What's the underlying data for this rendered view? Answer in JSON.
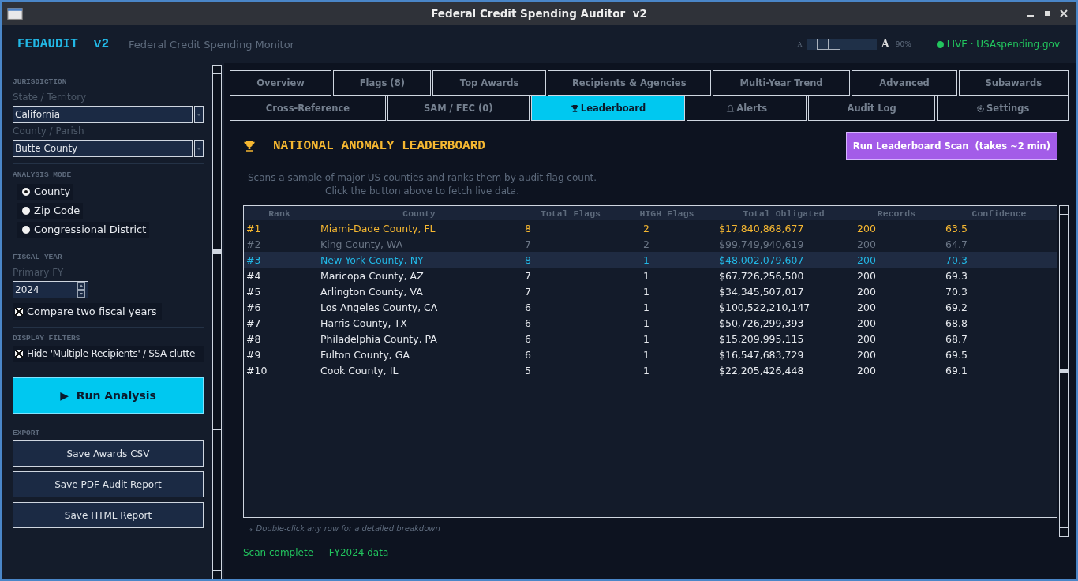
{
  "window": {
    "title": "Federal Credit Spending Auditor  v2"
  },
  "header": {
    "brand": "FEDAUDIT",
    "version": "v2",
    "subtitle": "Federal Credit Spending Monitor",
    "zoom": {
      "small_label": "A",
      "large_label": "A",
      "level": 0.2,
      "reading": "90%"
    },
    "status": {
      "text": "LIVE · USAspending.gov",
      "color": "#22c55e"
    }
  },
  "sidebar": {
    "jurisdiction": {
      "heading": "JURISDICTION",
      "fields": [
        {
          "label": "State / Territory",
          "value": "California"
        },
        {
          "label": "County / Parish",
          "value": "Butte County"
        }
      ]
    },
    "analysis_mode": {
      "heading": "ANALYSIS MODE",
      "options": [
        {
          "label": "County",
          "selected": true
        },
        {
          "label": "Zip Code",
          "selected": false
        },
        {
          "label": "Congressional District",
          "selected": false
        }
      ]
    },
    "fiscal_year": {
      "heading": "FISCAL YEAR",
      "label": "Primary FY",
      "value": "2024",
      "compare": {
        "label": "Compare two fiscal years",
        "checked": true
      }
    },
    "display_filters": {
      "heading": "DISPLAY FILTERS",
      "hide": {
        "label": "Hide 'Multiple Recipients' / SSA clutte",
        "checked": true
      }
    },
    "run_button": "▶  Run Analysis",
    "export": {
      "heading": "EXPORT",
      "buttons": [
        "Save Awards CSV",
        "Save PDF Audit Report",
        "Save HTML Report"
      ]
    }
  },
  "tabs": [
    [
      {
        "label": "Overview",
        "selected": false
      },
      {
        "label": "Flags (8)",
        "selected": false
      },
      {
        "label": "Top Awards",
        "selected": false
      },
      {
        "label": "Recipients & Agencies",
        "selected": false
      },
      {
        "label": "Multi-Year Trend",
        "selected": false
      },
      {
        "label": "Advanced",
        "selected": false
      },
      {
        "label": "Subawards",
        "selected": false
      }
    ],
    [
      {
        "label": "Cross-Reference",
        "selected": false
      },
      {
        "label": "SAM / FEC (0)",
        "selected": false
      },
      {
        "label": "Leaderboard",
        "selected": true
      },
      {
        "label": "Alerts",
        "selected": false
      },
      {
        "label": "Audit Log",
        "selected": false
      },
      {
        "label": "Settings",
        "selected": false
      }
    ]
  ],
  "leaderboard": {
    "title": "NATIONAL ANOMALY LEADERBOARD",
    "scan_button": "Run Leaderboard Scan  (takes ~2 min)",
    "description": [
      "Scans a sample of major US counties and ranks them by audit flag count.",
      "Click the button above to fetch live data."
    ],
    "table": {
      "columns": [
        "Rank",
        "County",
        "Total Flags",
        "HIGH Flags",
        "Total Obligated",
        "Records",
        "Confidence"
      ],
      "rows": [
        {
          "cells": [
            "#1",
            "Miami-Dade County, FL",
            "8",
            "2",
            "$17,840,868,677",
            "200",
            "63.5"
          ],
          "color": "#f5b731",
          "selected": false
        },
        {
          "cells": [
            "#2",
            "King County, WA",
            "7",
            "2",
            "$99,749,940,619",
            "200",
            "64.7"
          ],
          "color": "#6b7686",
          "selected": false
        },
        {
          "cells": [
            "#3",
            "New York County, NY",
            "8",
            "1",
            "$48,002,079,607",
            "200",
            "70.3"
          ],
          "color": "#22b8e6",
          "selected": true
        },
        {
          "cells": [
            "#4",
            "Maricopa County, AZ",
            "7",
            "1",
            "$67,726,256,500",
            "200",
            "69.3"
          ],
          "color": "#e6e9ee",
          "selected": false
        },
        {
          "cells": [
            "#5",
            "Arlington County, VA",
            "7",
            "1",
            "$34,345,507,017",
            "200",
            "70.3"
          ],
          "color": "#e6e9ee",
          "selected": false
        },
        {
          "cells": [
            "#6",
            "Los Angeles County, CA",
            "6",
            "1",
            "$100,522,210,147",
            "200",
            "69.2"
          ],
          "color": "#e6e9ee",
          "selected": false
        },
        {
          "cells": [
            "#7",
            "Harris County, TX",
            "6",
            "1",
            "$50,726,299,393",
            "200",
            "68.8"
          ],
          "color": "#e6e9ee",
          "selected": false
        },
        {
          "cells": [
            "#8",
            "Philadelphia County, PA",
            "6",
            "1",
            "$15,209,995,115",
            "200",
            "68.7"
          ],
          "color": "#e6e9ee",
          "selected": false
        },
        {
          "cells": [
            "#9",
            "Fulton County, GA",
            "6",
            "1",
            "$16,547,683,729",
            "200",
            "69.5"
          ],
          "color": "#e6e9ee",
          "selected": false
        },
        {
          "cells": [
            "#10",
            "Cook County, IL",
            "5",
            "1",
            "$22,205,426,448",
            "200",
            "69.1"
          ],
          "color": "#e6e9ee",
          "selected": false
        }
      ]
    },
    "hint": "↳  Double-click any row for a detailed breakdown",
    "status": "Scan complete — FY2024 data"
  }
}
